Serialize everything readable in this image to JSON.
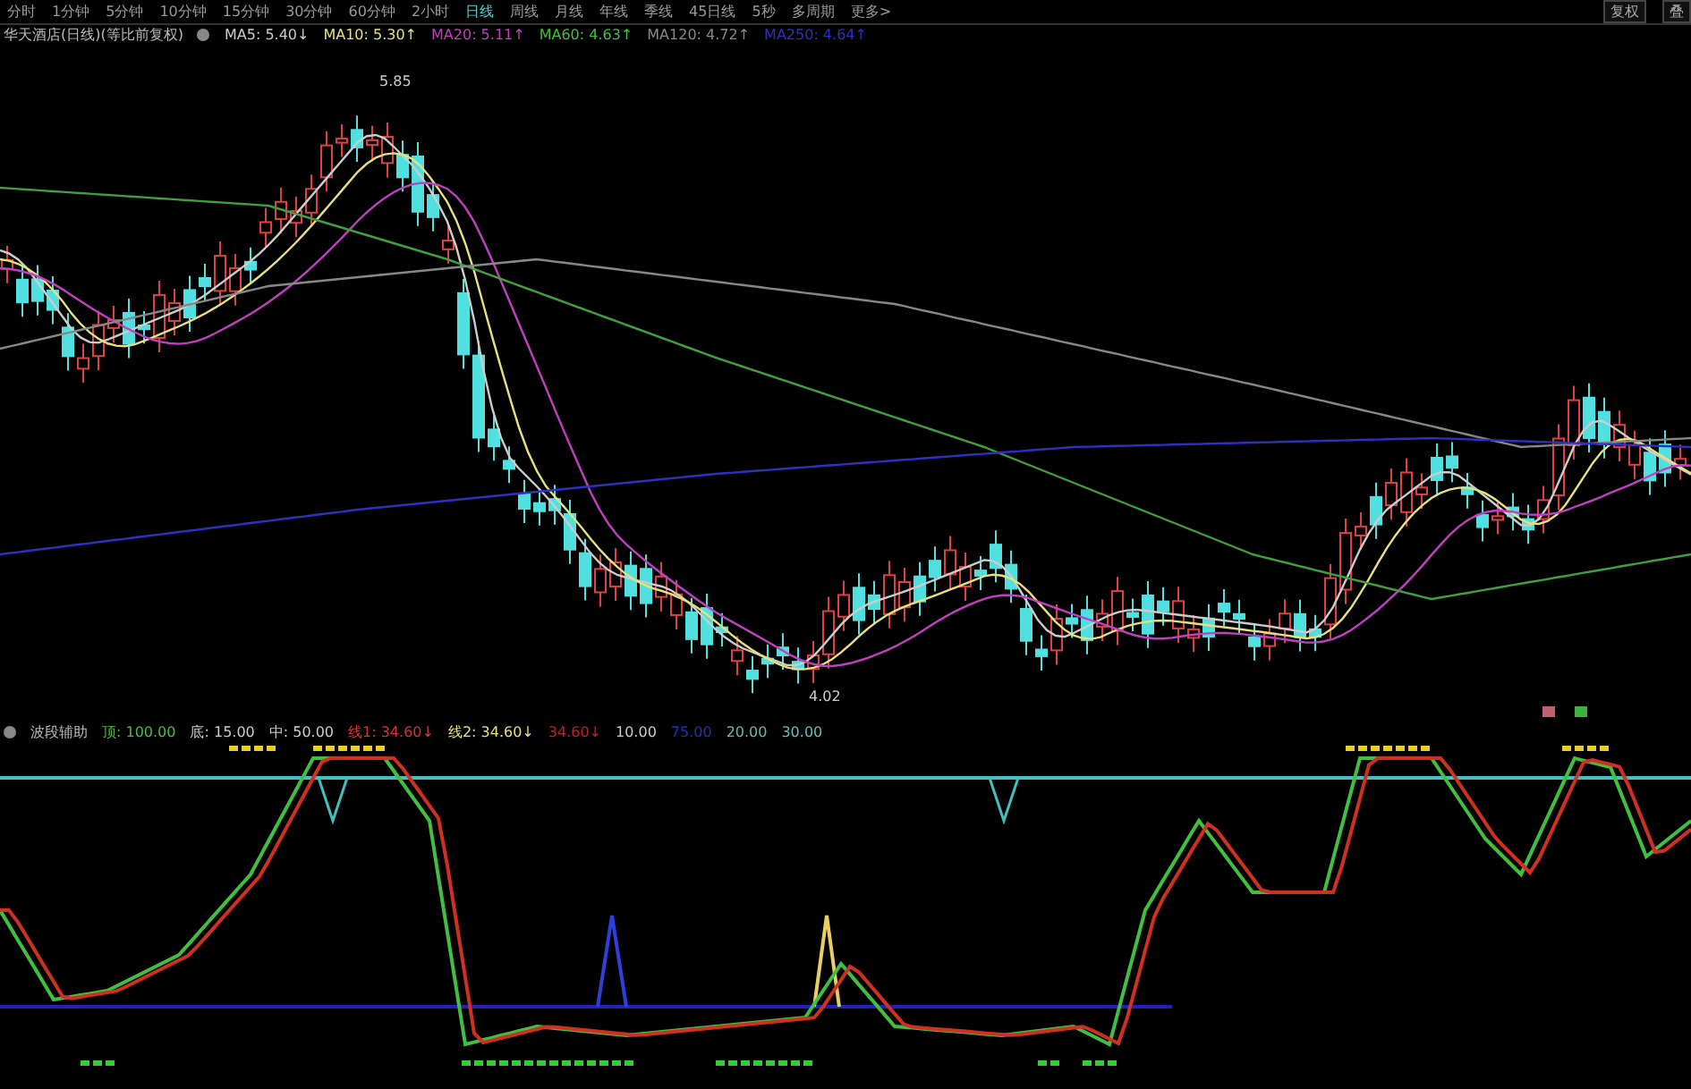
{
  "period_tabs": [
    {
      "label": "分时",
      "selected": false
    },
    {
      "label": "1分钟",
      "selected": false
    },
    {
      "label": "5分钟",
      "selected": false
    },
    {
      "label": "10分钟",
      "selected": false
    },
    {
      "label": "15分钟",
      "selected": false
    },
    {
      "label": "30分钟",
      "selected": false
    },
    {
      "label": "60分钟",
      "selected": false
    },
    {
      "label": "2小时",
      "selected": false
    },
    {
      "label": "日线",
      "selected": true
    },
    {
      "label": "周线",
      "selected": false
    },
    {
      "label": "月线",
      "selected": false
    },
    {
      "label": "年线",
      "selected": false
    },
    {
      "label": "季线",
      "selected": false
    },
    {
      "label": "45日线",
      "selected": false
    },
    {
      "label": "5秒",
      "selected": false
    },
    {
      "label": "多周期",
      "selected": false
    },
    {
      "label": "更多>",
      "selected": false
    }
  ],
  "toolbar_buttons": [
    "复权",
    "叠"
  ],
  "chart_title": "华天酒店(日线)(等比前复权)",
  "ma_legend": [
    {
      "text": "MA5: 5.40↓",
      "color": "#cccccc"
    },
    {
      "text": "MA10: 5.30↑",
      "color": "#e8e07a"
    },
    {
      "text": "MA20: 5.11↑",
      "color": "#c040c0"
    },
    {
      "text": "MA60: 4.63↑",
      "color": "#40c040"
    },
    {
      "text": "MA120: 4.72↑",
      "color": "#888888"
    },
    {
      "text": "MA250: 4.64↑",
      "color": "#3030c0"
    }
  ],
  "price_labels": {
    "high": "5.85",
    "low": "4.02"
  },
  "indicator": {
    "name": "波段辅助",
    "values": [
      {
        "text": "顶: 100.00",
        "color": "#40c040"
      },
      {
        "text": "底: 15.00",
        "color": "#cccccc"
      },
      {
        "text": "中: 50.00",
        "color": "#cccccc"
      },
      {
        "text": "线1: 34.60↓",
        "color": "#e03030"
      },
      {
        "text": "线2: 34.60↓",
        "color": "#e8e07a"
      },
      {
        "text": "34.60↓",
        "color": "#c02020"
      },
      {
        "text": "10.00",
        "color": "#cccccc"
      },
      {
        "text": "75.00",
        "color": "#2030c0"
      },
      {
        "text": "20.00",
        "color": "#60c0a0"
      },
      {
        "text": "30.00",
        "color": "#60c0c0"
      }
    ]
  }
}
